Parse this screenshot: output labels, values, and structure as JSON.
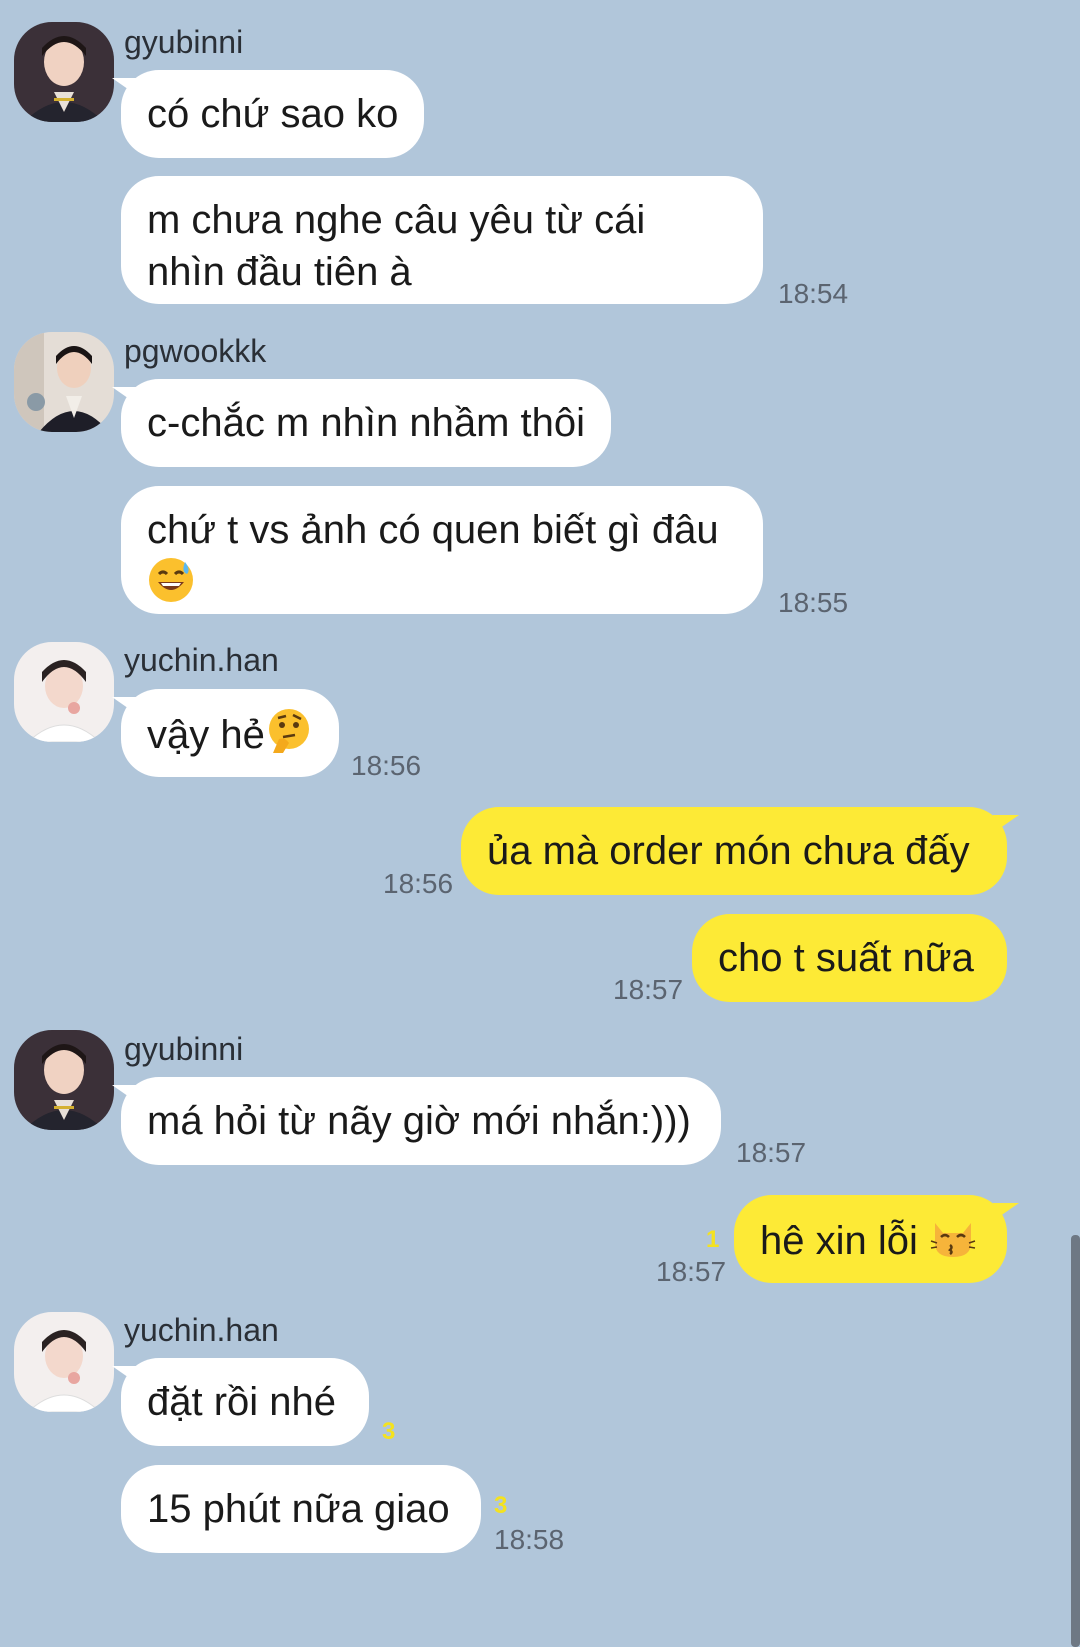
{
  "messages": [
    {
      "sender": "gyubinni",
      "bubbles": [
        "có chứ sao ko",
        "m chưa nghe câu yêu từ cái",
        "nhìn đầu tiên à"
      ],
      "time": "18:54"
    },
    {
      "sender": "pgwookkk",
      "bubbles": [
        "c-chắc m nhìn nhầm thôi",
        "chứ t vs ảnh có quen biết gì đâu"
      ],
      "emoji": "sweat-smile-emoji",
      "time": "18:55"
    },
    {
      "sender": "yuchin.han",
      "bubbles": [
        "vậy hẻ"
      ],
      "emoji": "thinking-face-emoji",
      "time": "18:56"
    },
    {
      "sender": "me",
      "bubbles": [
        "ủa mà order món chưa đấy"
      ],
      "time": "18:56"
    },
    {
      "sender": "me",
      "bubbles": [
        "cho t suất nữa"
      ],
      "time": "18:57"
    },
    {
      "sender": "gyubinni",
      "bubbles": [
        "má hỏi từ nãy giờ mới nhắn:)))"
      ],
      "time": "18:57"
    },
    {
      "sender": "me",
      "bubbles": [
        "hê xin lỗi"
      ],
      "emoji": "kissing-cat-emoji",
      "unread": "1",
      "time": "18:57"
    },
    {
      "sender": "yuchin.han",
      "bubbles": [
        "đặt rồi nhé",
        "15 phút nữa giao"
      ],
      "unread": [
        "3",
        "3"
      ],
      "time": "18:58"
    }
  ],
  "colors": {
    "background": "#b1c6da",
    "incoming_bubble": "#ffffff",
    "outgoing_bubble": "#fdea36",
    "unread_count": "#f4e21f"
  }
}
